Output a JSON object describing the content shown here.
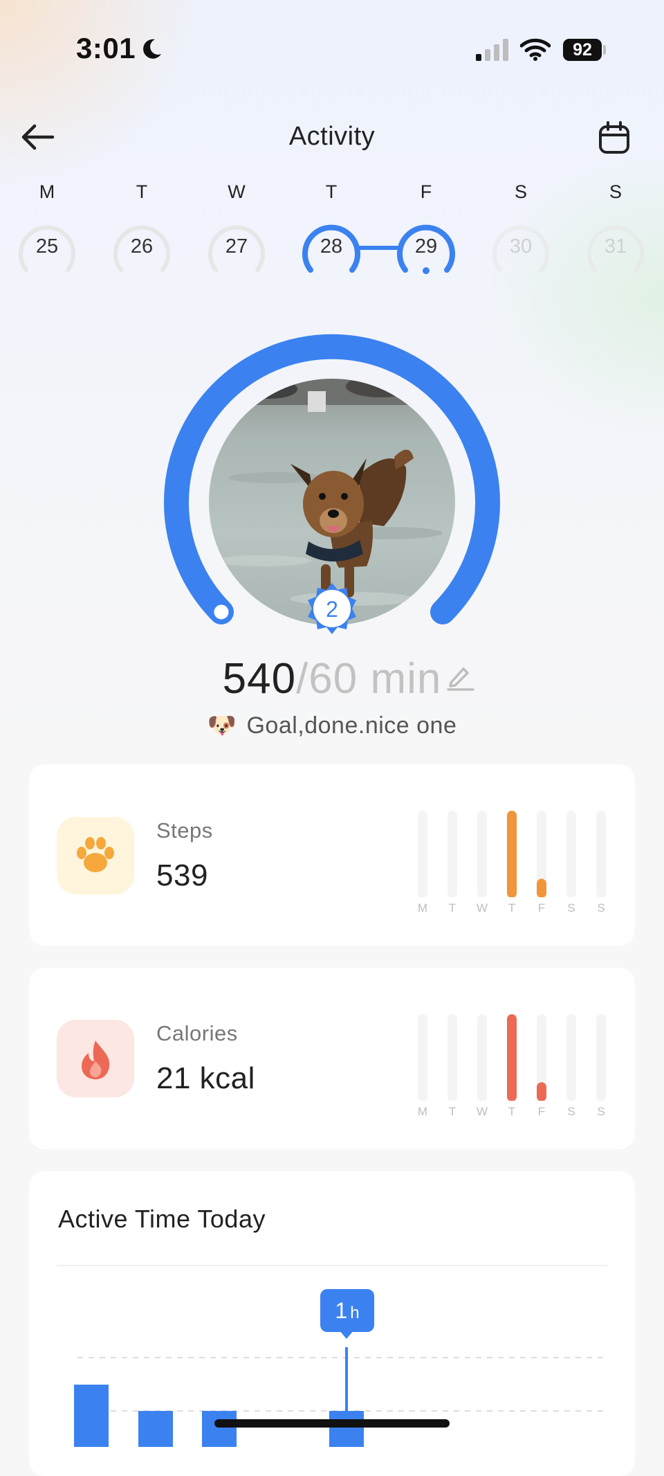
{
  "status_bar": {
    "time": "3:01",
    "battery": "92"
  },
  "header": {
    "title": "Activity"
  },
  "week": {
    "days": [
      {
        "letter": "M",
        "date": "25",
        "state": "normal"
      },
      {
        "letter": "T",
        "date": "26",
        "state": "normal"
      },
      {
        "letter": "W",
        "date": "27",
        "state": "normal"
      },
      {
        "letter": "T",
        "date": "28",
        "state": "active"
      },
      {
        "letter": "F",
        "date": "29",
        "state": "selected"
      },
      {
        "letter": "S",
        "date": "30",
        "state": "future"
      },
      {
        "letter": "S",
        "date": "31",
        "state": "future"
      }
    ]
  },
  "goal": {
    "value": "540",
    "separator": "/",
    "target": "60 min",
    "badge": "2",
    "emoji": "🐶",
    "message": "Goal,done.nice one",
    "ring_progress": 1.0
  },
  "steps": {
    "label": "Steps",
    "value": "539",
    "color": "#f0953a",
    "icon": "paw-icon",
    "week_labels": [
      "M",
      "T",
      "W",
      "T",
      "F",
      "S",
      "S"
    ],
    "week_values": [
      0,
      0,
      0,
      100,
      22,
      0,
      0
    ]
  },
  "calories": {
    "label": "Calories",
    "value": "21 kcal",
    "color": "#ec6a55",
    "icon": "flame-icon",
    "week_labels": [
      "M",
      "T",
      "W",
      "T",
      "F",
      "S",
      "S"
    ],
    "week_values": [
      0,
      0,
      0,
      100,
      22,
      0,
      0
    ]
  },
  "active_time": {
    "title": "Active Time Today",
    "tooltip_value": "1",
    "tooltip_unit": "h"
  },
  "colors": {
    "accent": "#3b82f0",
    "track": "#e6e6e6"
  }
}
